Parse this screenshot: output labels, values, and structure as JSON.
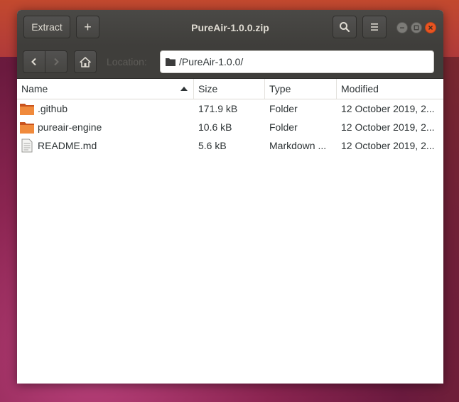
{
  "window": {
    "title": "PureAir-1.0.0.zip"
  },
  "headerbar": {
    "extract_label": "Extract",
    "add_symbol": "+",
    "search_icon": "search-icon",
    "menu_icon": "hamburger-menu-icon"
  },
  "toolbar": {
    "location_label": "Location:",
    "location_value": "/PureAir-1.0.0/"
  },
  "columns": {
    "name": "Name",
    "size": "Size",
    "type": "Type",
    "modified": "Modified"
  },
  "files": [
    {
      "name": ".github",
      "size": "171.9 kB",
      "type": "Folder",
      "modified": "12 October 2019, 2...",
      "icon": "folder-icon"
    },
    {
      "name": "pureair-engine",
      "size": "10.6 kB",
      "type": "Folder",
      "modified": "12 October 2019, 2...",
      "icon": "folder-icon"
    },
    {
      "name": "README.md",
      "size": "5.6 kB",
      "type": "Markdown ...",
      "modified": "12 October 2019, 2...",
      "icon": "text-file-icon"
    }
  ],
  "colors": {
    "accent": "#e95420",
    "folder": "#e0782f",
    "headerbar": "#3f3e3b"
  }
}
